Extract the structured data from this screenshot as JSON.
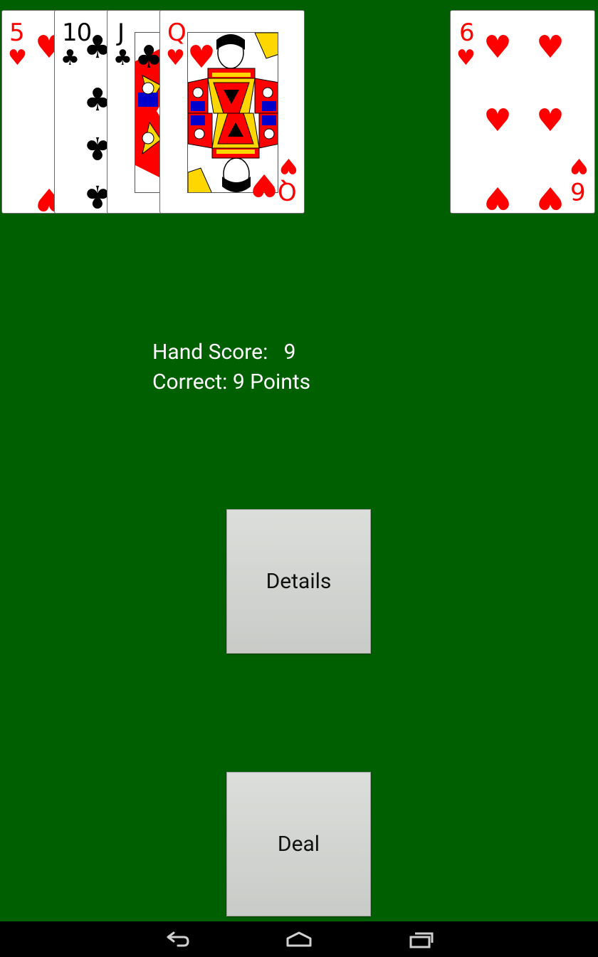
{
  "hand": {
    "cards": [
      {
        "rank": "5",
        "suit_icon": "heart-icon",
        "suit_glyph": "♥",
        "color": "#ff0000"
      },
      {
        "rank": "10",
        "suit_icon": "club-icon",
        "suit_glyph": "♣",
        "color": "#000000"
      },
      {
        "rank": "J",
        "suit_icon": "club-icon",
        "suit_glyph": "♣",
        "color": "#000000"
      },
      {
        "rank": "Q",
        "suit_icon": "heart-icon",
        "suit_glyph": "♥",
        "color": "#ff0000"
      }
    ]
  },
  "starter": {
    "rank": "6",
    "suit_icon": "heart-icon",
    "suit_glyph": "♥",
    "color": "#ff0000"
  },
  "score": {
    "hand_score_label": "Hand Score:   9",
    "correct_label": "Correct: 9 Points"
  },
  "buttons": {
    "details": "Details",
    "deal": "Deal"
  },
  "colors": {
    "felt": "#005f00",
    "red_suit": "#ff0000",
    "black_suit": "#000000"
  },
  "navbar": {
    "icons": [
      "back-icon",
      "home-icon",
      "recent-apps-icon"
    ]
  }
}
